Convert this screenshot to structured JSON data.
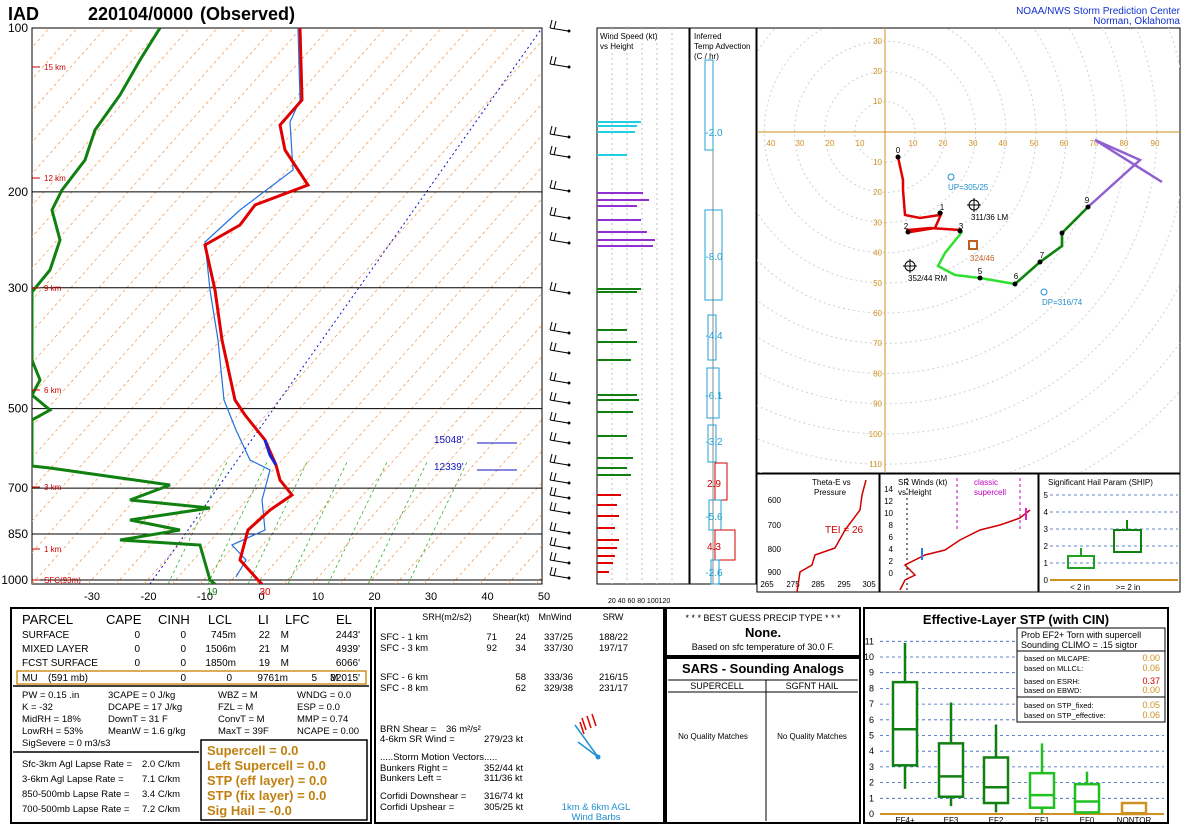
{
  "header": {
    "station": "IAD",
    "datetime": "220104/0000",
    "obs": "(Observed)",
    "org1": "NOAA/NWS Storm Prediction Center",
    "org2": "Norman, Oklahoma"
  },
  "skewt": {
    "pressure_labels": [
      "100",
      "200",
      "300",
      "500",
      "700",
      "850",
      "1000"
    ],
    "temp_labels": [
      "-30",
      "-20",
      "-10",
      "0",
      "10",
      "20",
      "30",
      "40",
      "50"
    ],
    "height_labels": [
      "15 km",
      "12 km",
      "9 km",
      "6 km",
      "3 km",
      "1 km",
      "SFC(93m)"
    ],
    "level_labels": [
      "15048'",
      "12339'"
    ],
    "sfc_dewpoint": "19",
    "sfc_temp": "30"
  },
  "wind_speed_panel": {
    "title1": "Wind Speed (kt)",
    "title2": "vs Height",
    "axis": "20 40 60 80 100120"
  },
  "temp_adv_panel": {
    "title1": "Inferred",
    "title2": "Temp Advection",
    "title3": "(C / hr)",
    "values": [
      "-2.0",
      "-8.0",
      "-4.4",
      "-6.1",
      "-3.2",
      "2.9",
      "-5.6",
      "4.3",
      "-2.6"
    ]
  },
  "hodograph": {
    "x_labels": [
      "40",
      "30",
      "20",
      "10",
      "10",
      "20",
      "30",
      "40",
      "50",
      "60",
      "70",
      "80",
      "90"
    ],
    "y_labels_up": [
      "30",
      "20",
      "10"
    ],
    "y_labels_down": [
      "10",
      "20",
      "30",
      "40",
      "50",
      "60",
      "70",
      "80",
      "90",
      "100",
      "110"
    ],
    "points": [
      "0",
      "1",
      "2",
      "3",
      "5",
      "6",
      "7",
      "9"
    ],
    "up": "UP=305/25",
    "lm": "311/36 LM",
    "rm": "352/44 RM",
    "esrh": "324/46",
    "dn": "DP=316/74"
  },
  "theta_panel": {
    "title1": "Theta-E vs",
    "title2": "Pressure",
    "tei": "TEI = 26",
    "y_labels": [
      "600",
      "700",
      "800",
      "900"
    ],
    "x_labels": [
      "265",
      "275",
      "285",
      "295",
      "305"
    ]
  },
  "srwind_panel": {
    "title1": "SR Winds (kt)",
    "title2": "vs Height",
    "classic1": "classic",
    "classic2": "supercell",
    "y_labels": [
      "14",
      "12",
      "10",
      "8",
      "6",
      "4",
      "2",
      "0"
    ],
    "x_labels": [
      "0",
      "20",
      "40",
      "60",
      "80"
    ]
  },
  "ship_panel": {
    "title": "Significant Hail Param (SHIP)",
    "y_labels": [
      "5",
      "4",
      "3",
      "2",
      "1",
      "0"
    ],
    "x_labels": [
      "< 2 in",
      ">= 2 in"
    ]
  },
  "parcel_table": {
    "headers": [
      "PARCEL",
      "CAPE",
      "CINH",
      "LCL",
      "LI",
      "LFC",
      "EL"
    ],
    "rows": [
      [
        "SURFACE",
        "0",
        "0",
        "745m",
        "22",
        "M",
        "2443'"
      ],
      [
        "MIXED LAYER",
        "0",
        "0",
        "1506m",
        "21",
        "M",
        "4939'"
      ],
      [
        "FCST SURFACE",
        "0",
        "0",
        "1850m",
        "19",
        "M",
        "6066'"
      ],
      [
        "MU",
        "(591 mb)",
        "0",
        "0",
        "9761m",
        "5",
        "M",
        "32015'"
      ]
    ]
  },
  "indices": {
    "col1": [
      "PW = 0.15 .in",
      "K = -32",
      "MidRH = 18%",
      "LowRH = 53%",
      "SigSevere = 0 m3/s3"
    ],
    "col2": [
      "3CAPE = 0 J/kg",
      "DCAPE = 17 J/kg",
      "DownT = 31 F",
      "MeanW = 1.6 g/kg"
    ],
    "col3": [
      "WBZ = M",
      "FZL = M",
      "ConvT = M",
      "MaxT = 39F"
    ],
    "col4": [
      "WNDG = 0.0",
      "ESP = 0.0",
      "MMP = 0.74",
      "NCAPE = 0.00"
    ]
  },
  "lapse": [
    [
      "Sfc-3km Agl Lapse Rate =",
      "2.0 C/km"
    ],
    [
      "3-6km Agl Lapse Rate =",
      "7.1 C/km"
    ],
    [
      "850-500mb Lapse Rate =",
      "3.4 C/km"
    ],
    [
      "700-500mb Lapse Rate =",
      "7.2 C/km"
    ]
  ],
  "composite": [
    "Supercell = 0.0",
    "Left Supercell = 0.0",
    "STP (eff layer) = 0.0",
    "STP (fix layer) = 0.0",
    "Sig Hail = -0.0"
  ],
  "kinematics": {
    "headers": [
      "SRH(m2/s2)",
      "Shear(kt)",
      "MnWind",
      "SRW"
    ],
    "rows": [
      [
        "SFC - 1 km",
        "71",
        "24",
        "337/25",
        "188/22"
      ],
      [
        "SFC - 3 km",
        "92",
        "34",
        "337/30",
        "197/17"
      ],
      [
        "SFC - 6 km",
        "",
        "58",
        "333/36",
        "216/15"
      ],
      [
        "SFC - 8 km",
        "",
        "62",
        "329/38",
        "231/17"
      ]
    ],
    "brn_label": "BRN Shear =",
    "brn_value": "36 m²/s²",
    "srwind_label": "4-6km SR Wind =",
    "srwind_value": "279/23 kt",
    "smv_title": ".....Storm Motion Vectors.....",
    "bunkers_right_label": "Bunkers Right =",
    "bunkers_right": "352/44 kt",
    "bunkers_left_label": "Bunkers Left =",
    "bunkers_left": "311/36 kt",
    "corfidi_down_label": "Corfidi Downshear =",
    "corfidi_down": "316/74 kt",
    "corfidi_up_label": "Corfidi Upshear =",
    "corfidi_up": "305/25 kt",
    "barbs_label1": "1km & 6km AGL",
    "barbs_label2": "Wind Barbs"
  },
  "precip": {
    "title": "* * * BEST GUESS PRECIP TYPE * * *",
    "value": "None.",
    "note": "Based on sfc temperature of 30.0 F."
  },
  "sars": {
    "title": "SARS - Sounding Analogs",
    "col1": "SUPERCELL",
    "col2": "SGFNT HAIL",
    "nomatch1": "No Quality Matches",
    "nomatch2": "No Quality Matches"
  },
  "stp": {
    "title": "Effective-Layer STP (with CIN)",
    "prob1": "Prob EF2+ Torn with supercell",
    "prob2": "Sounding CLIMO = .15 sigtor",
    "based": [
      [
        "based on MLCAPE:",
        "0.00"
      ],
      [
        "based on MLLCL:",
        "0.06"
      ],
      [
        "based on ESRH:",
        "0.37"
      ],
      [
        "based on EBWD:",
        "0.00"
      ],
      [
        "based on STP_fixed:",
        "0.05"
      ],
      [
        "based on STP_effective:",
        "0.06"
      ]
    ],
    "y_labels": [
      "11",
      "10",
      "9",
      "8",
      "7",
      "6",
      "5",
      "4",
      "3",
      "2",
      "1",
      "0"
    ],
    "x_labels": [
      "EF4+",
      "EF3",
      "EF2",
      "EF1",
      "EF0",
      "NONTOR"
    ]
  },
  "chart_data": [
    {
      "type": "line",
      "title": "Skew-T log-P",
      "xlabel": "",
      "ylabel": "",
      "pressure_levels": [
        100,
        200,
        300,
        500,
        700,
        850,
        1000
      ],
      "temp_axis": [
        -30,
        -20,
        -10,
        0,
        10,
        20,
        30,
        40,
        50
      ],
      "series": [
        {
          "name": "Temperature",
          "color": "#e00000",
          "points": [
            [
              -33,
              100
            ],
            [
              -33,
              150
            ],
            [
              -28,
              180
            ],
            [
              -42,
              210
            ],
            [
              -48,
              250
            ],
            [
              -37,
              300
            ],
            [
              -28,
              400
            ],
            [
              -22,
              500
            ],
            [
              -10,
              600
            ],
            [
              -2,
              700
            ],
            [
              -6,
              800
            ],
            [
              -6,
              900
            ],
            [
              -2,
              1000
            ]
          ]
        },
        {
          "name": "Dewpoint",
          "color": "#1060e0",
          "points": [
            [
              -34,
              100
            ],
            [
              -34,
              150
            ],
            [
              -31,
              180
            ],
            [
              -43,
              210
            ],
            [
              -50,
              250
            ],
            [
              -40,
              300
            ],
            [
              -36,
              400
            ],
            [
              -30,
              500
            ],
            [
              -22,
              600
            ],
            [
              -20,
              700
            ],
            [
              -18,
              800
            ],
            [
              -18,
              900
            ],
            [
              -7,
              1000
            ]
          ]
        }
      ]
    },
    {
      "type": "scatter",
      "title": "Hodograph",
      "xlabel": "",
      "ylabel": "",
      "series": [
        {
          "name": "hodograph",
          "points": [
            [
              3,
              12
            ],
            [
              18,
              28
            ],
            [
              8,
              33
            ],
            [
              24,
              34
            ],
            [
              31,
              47
            ],
            [
              44,
              49
            ],
            [
              53,
              39
            ],
            [
              60,
              28
            ],
            [
              68,
              18
            ]
          ]
        }
      ]
    },
    {
      "type": "bar",
      "title": "Effective-Layer STP (with CIN)",
      "categories": [
        "EF4+",
        "EF3",
        "EF2",
        "EF1",
        "EF0",
        "NONTOR"
      ],
      "series": [
        {
          "name": "box_low",
          "values": [
            3.1,
            1.1,
            0.7,
            0.4,
            0.1,
            0.0
          ]
        },
        {
          "name": "median",
          "values": [
            5.4,
            2.4,
            1.7,
            1.2,
            0.8,
            0.05
          ]
        },
        {
          "name": "box_high",
          "values": [
            8.4,
            4.5,
            3.6,
            2.6,
            1.9,
            0.7
          ]
        }
      ],
      "ylim": [
        0,
        11
      ]
    }
  ]
}
